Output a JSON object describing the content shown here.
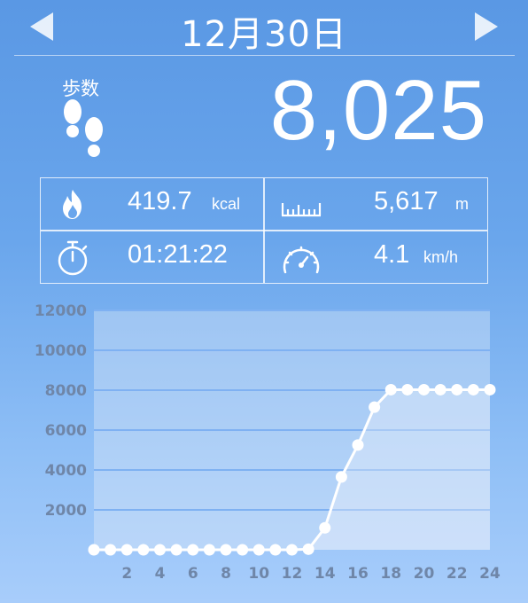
{
  "header": {
    "date_title": "12月30日"
  },
  "summary": {
    "steps_label": "歩数",
    "steps_value": "8,025"
  },
  "stats": {
    "calories": {
      "value": "419.7",
      "unit": "kcal",
      "icon": "flame-icon"
    },
    "distance": {
      "value": "5,617",
      "unit": "m",
      "icon": "ruler-icon"
    },
    "duration": {
      "value": "01:21:22",
      "icon": "stopwatch-icon"
    },
    "speed": {
      "value": "4.1",
      "unit": "km/h",
      "icon": "speedometer-icon"
    }
  },
  "colors": {
    "background_top": "#5a98e4",
    "background_bottom": "#a8cdfb",
    "axis_text": "#6f86a8",
    "gridline": "#7fb1f2",
    "line": "#ffffff"
  },
  "chart_data": {
    "type": "line",
    "x": [
      0,
      1,
      2,
      3,
      4,
      5,
      6,
      7,
      8,
      9,
      10,
      11,
      12,
      13,
      14,
      15,
      16,
      17,
      18,
      19,
      20,
      21,
      22,
      23,
      24
    ],
    "series": [
      {
        "values": [
          0,
          0,
          0,
          0,
          0,
          0,
          0,
          0,
          0,
          0,
          0,
          0,
          0,
          30,
          1100,
          3650,
          5250,
          7150,
          8025,
          8025,
          8025,
          8025,
          8025,
          8025,
          8025
        ]
      }
    ],
    "xticks": [
      "2",
      "4",
      "6",
      "8",
      "10",
      "12",
      "14",
      "16",
      "18",
      "20",
      "22",
      "24"
    ],
    "yticks": [
      "2000",
      "4000",
      "6000",
      "8000",
      "10000",
      "12000"
    ],
    "xlim": [
      0,
      24
    ],
    "ylim": [
      0,
      12000
    ],
    "grid": true
  }
}
